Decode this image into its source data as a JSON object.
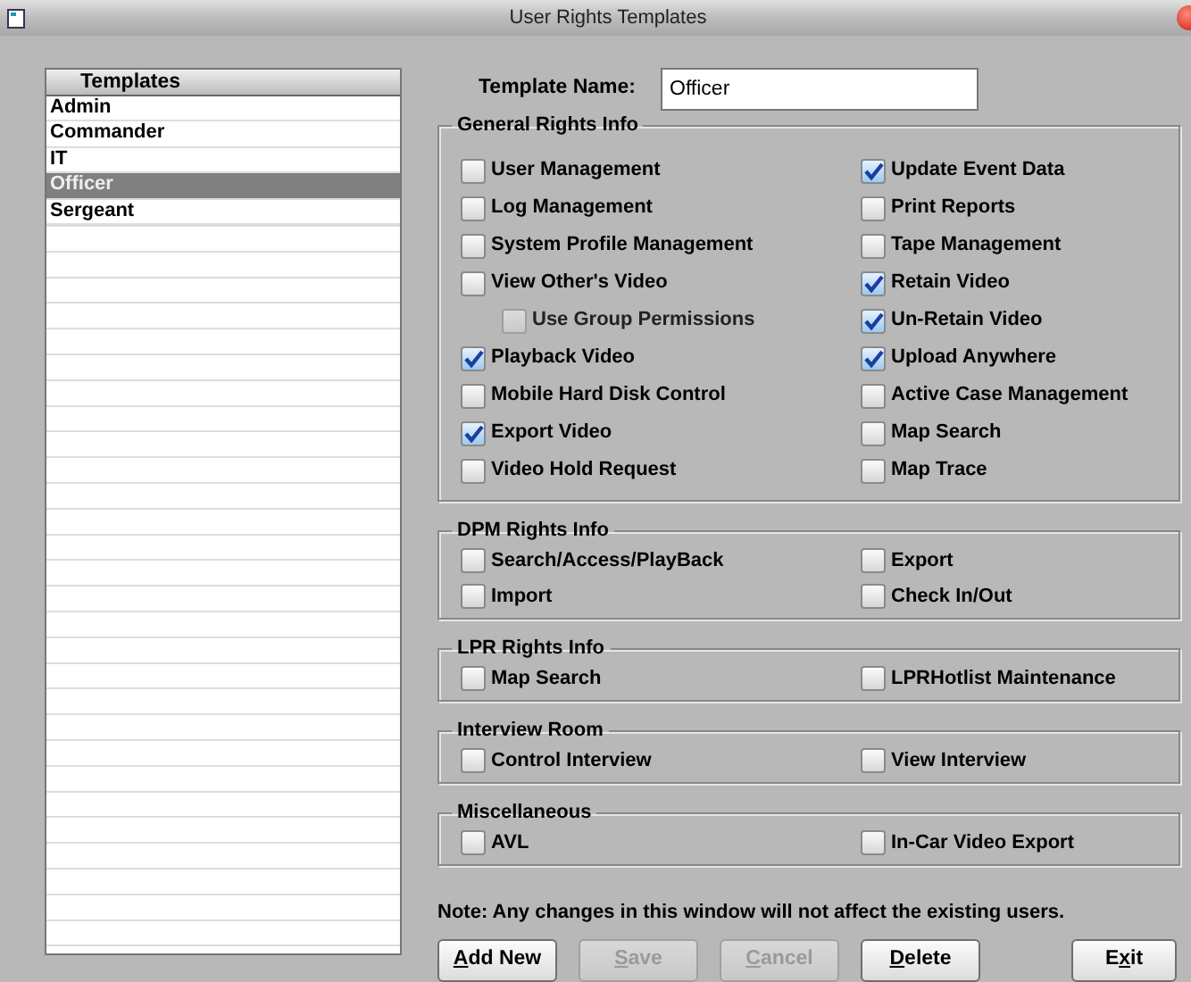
{
  "window": {
    "title": "User Rights Templates"
  },
  "templates": {
    "header": "Templates",
    "items": [
      {
        "label": "Admin",
        "selected": false
      },
      {
        "label": "Commander",
        "selected": false
      },
      {
        "label": "IT",
        "selected": false
      },
      {
        "label": "Officer",
        "selected": true
      },
      {
        "label": "Sergeant",
        "selected": false
      }
    ]
  },
  "template_name": {
    "label": "Template Name:",
    "value": "Officer"
  },
  "groups": [
    {
      "title": "General Rights Info",
      "columns": [
        [
          {
            "label": "User Management",
            "checked": false
          },
          {
            "label": "Log Management",
            "checked": false
          },
          {
            "label": "System Profile Management",
            "checked": false
          },
          {
            "label": "View Other's Video",
            "checked": false,
            "children": [
              {
                "label": "Use Group Permissions",
                "checked": false,
                "disabled": true
              }
            ]
          },
          {
            "label": "Playback Video",
            "checked": true
          },
          {
            "label": "Mobile Hard Disk Control",
            "checked": false
          },
          {
            "label": "Export Video",
            "checked": true
          },
          {
            "label": "Video Hold Request",
            "checked": false
          }
        ],
        [
          {
            "label": "Update Event Data",
            "checked": true
          },
          {
            "label": "Print Reports",
            "checked": false
          },
          {
            "label": "Tape Management",
            "checked": false
          },
          {
            "label": "Retain Video",
            "checked": true
          },
          {
            "label": "Un-Retain  Video",
            "checked": true
          },
          {
            "label": "Upload Anywhere",
            "checked": true
          },
          {
            "label": "Active Case Management",
            "checked": false
          },
          {
            "label": "Map Search",
            "checked": false
          },
          {
            "label": "Map Trace",
            "checked": false
          }
        ]
      ]
    },
    {
      "title": "DPM Rights Info",
      "columns": [
        [
          {
            "label": "Search/Access/PlayBack",
            "checked": false
          },
          {
            "label": "Import",
            "checked": false
          }
        ],
        [
          {
            "label": "Export",
            "checked": false
          },
          {
            "label": "Check In/Out",
            "checked": false
          }
        ]
      ]
    },
    {
      "title": "LPR Rights Info",
      "columns": [
        [
          {
            "label": "Map Search",
            "checked": false
          }
        ],
        [
          {
            "label": "LPRHotlist Maintenance",
            "checked": false
          }
        ]
      ]
    },
    {
      "title": "Interview Room",
      "columns": [
        [
          {
            "label": "Control Interview",
            "checked": false
          }
        ],
        [
          {
            "label": "View Interview",
            "checked": false
          }
        ]
      ]
    },
    {
      "title": "Miscellaneous",
      "columns": [
        [
          {
            "label": "AVL",
            "checked": false
          }
        ],
        [
          {
            "label": "In-Car Video Export",
            "checked": false
          }
        ]
      ]
    }
  ],
  "note": "Note: Any changes in this window will not affect the existing users.",
  "buttons": [
    {
      "key": "A",
      "after": "dd New",
      "disabled": false
    },
    {
      "key": "S",
      "after": "ave",
      "disabled": true
    },
    {
      "key": "C",
      "after": "ancel",
      "disabled": true
    },
    {
      "key": "D",
      "after": "elete",
      "disabled": false
    },
    {
      "before": "E",
      "key": "x",
      "after": "it",
      "disabled": false
    }
  ]
}
